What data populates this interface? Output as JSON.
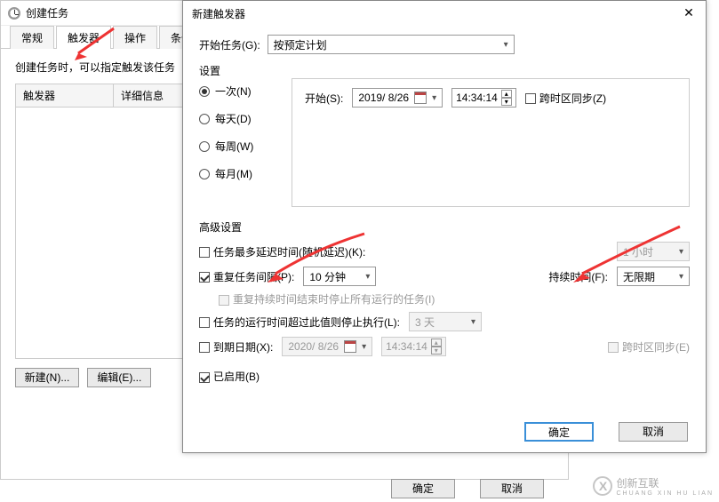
{
  "parent": {
    "title": "创建任务",
    "tabs": [
      "常规",
      "触发器",
      "操作",
      "条件"
    ],
    "active_tab_index": 1,
    "hint": "创建任务时，可以指定触发该任务",
    "columns": {
      "c1": "触发器",
      "c2": "详细信息"
    },
    "btn_new": "新建(N)...",
    "btn_edit": "编辑(E)...",
    "btn_ok": "确定",
    "btn_cancel": "取消"
  },
  "child": {
    "title": "新建触发器",
    "start_task_label": "开始任务(G):",
    "start_task_value": "按预定计划",
    "settings_label": "设置",
    "radios": {
      "once": "一次(N)",
      "daily": "每天(D)",
      "weekly": "每周(W)",
      "monthly": "每月(M)"
    },
    "start_label": "开始(S):",
    "start_date": "2019/ 8/26",
    "start_time": "14:34:14",
    "sync_tz": "跨时区同步(Z)",
    "adv_label": "高级设置",
    "delay_label": "任务最多延迟时间(随机延迟)(K):",
    "delay_value": "1 小时",
    "repeat_label": "重复任务间隔(P):",
    "repeat_value": "10 分钟",
    "duration_label": "持续时间(F):",
    "duration_value": "无限期",
    "stop_all_label": "重复持续时间结束时停止所有运行的任务(I)",
    "maxrun_label": "任务的运行时间超过此值则停止执行(L):",
    "maxrun_value": "3 天",
    "expire_label": "到期日期(X):",
    "expire_date": "2020/ 8/26",
    "expire_time": "14:34:14",
    "expire_sync": "跨时区同步(E)",
    "enabled_label": "已启用(B)",
    "btn_ok": "确定",
    "btn_cancel": "取消"
  },
  "watermark": {
    "brand": "创新互联",
    "sub": "CHUANG XIN HU LIAN"
  }
}
